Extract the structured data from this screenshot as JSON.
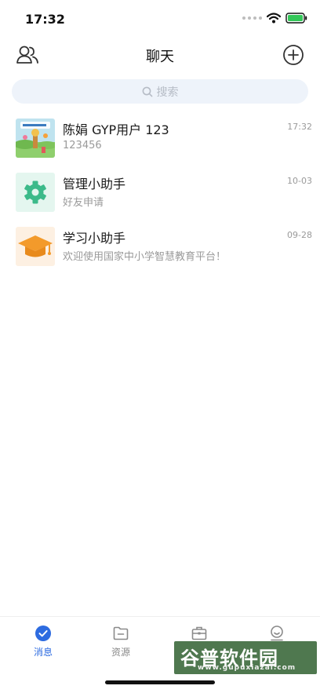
{
  "status_bar": {
    "time": "17:32"
  },
  "nav": {
    "title": "聊天"
  },
  "search": {
    "placeholder": "搜索"
  },
  "chats": [
    {
      "name": "陈娟 GYP用户 123",
      "preview": "123456",
      "time": "17:32",
      "avatar": "class-photo"
    },
    {
      "name": "管理小助手",
      "preview": "好友申请",
      "time": "10-03",
      "avatar": "gear-icon"
    },
    {
      "name": "学习小助手",
      "preview": "欢迎使用国家中小学智慧教育平台！",
      "time": "09-28",
      "avatar": "graduation-cap-icon"
    }
  ],
  "tabs": [
    {
      "label": "消息",
      "icon": "chat-check-icon",
      "active": true
    },
    {
      "label": "资源",
      "icon": "folder-icon",
      "active": false
    },
    {
      "label": "",
      "icon": "briefcase-icon",
      "active": false
    },
    {
      "label": "",
      "icon": "profile-icon",
      "active": false
    }
  ],
  "watermark": {
    "main": "谷普软件园",
    "sub": "www.gupuxiazai.com"
  },
  "colors": {
    "accent": "#2d6be0",
    "gear_green": "#3cba8a",
    "cap_orange": "#f39a2b",
    "search_bg": "#eef3fa"
  }
}
